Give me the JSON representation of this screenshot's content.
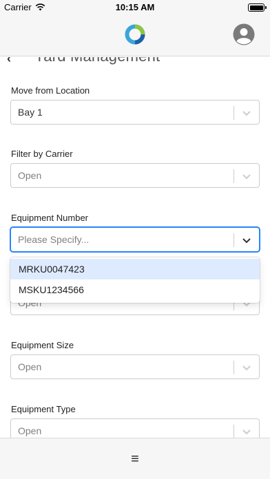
{
  "status_bar": {
    "carrier": "Carrier",
    "time": "10:15 AM"
  },
  "header": {
    "logo_icon": "app-logo-ring",
    "avatar_icon": "user-avatar-icon"
  },
  "page": {
    "title": "Yard Management",
    "back_icon": "chevron-left-icon"
  },
  "form": {
    "move_from": {
      "label": "Move from Location",
      "value": "Bay 1"
    },
    "carrier": {
      "label": "Filter by Carrier",
      "value": "Open"
    },
    "equipment_number": {
      "label": "Equipment Number",
      "placeholder": "Please Specify...",
      "options": [
        "MRKU0047423",
        "MSKU1234566"
      ]
    },
    "hidden_field": {
      "value": "Open"
    },
    "equipment_size": {
      "label": "Equipment Size",
      "value": "Open"
    },
    "equipment_type": {
      "label": "Equipment Type",
      "value": "Open"
    }
  },
  "bottom_bar": {
    "menu_icon": "≡"
  },
  "colors": {
    "bar_bg": "#f6f6f6",
    "focus_border": "#2684ff",
    "highlight_bg": "#deebff"
  }
}
